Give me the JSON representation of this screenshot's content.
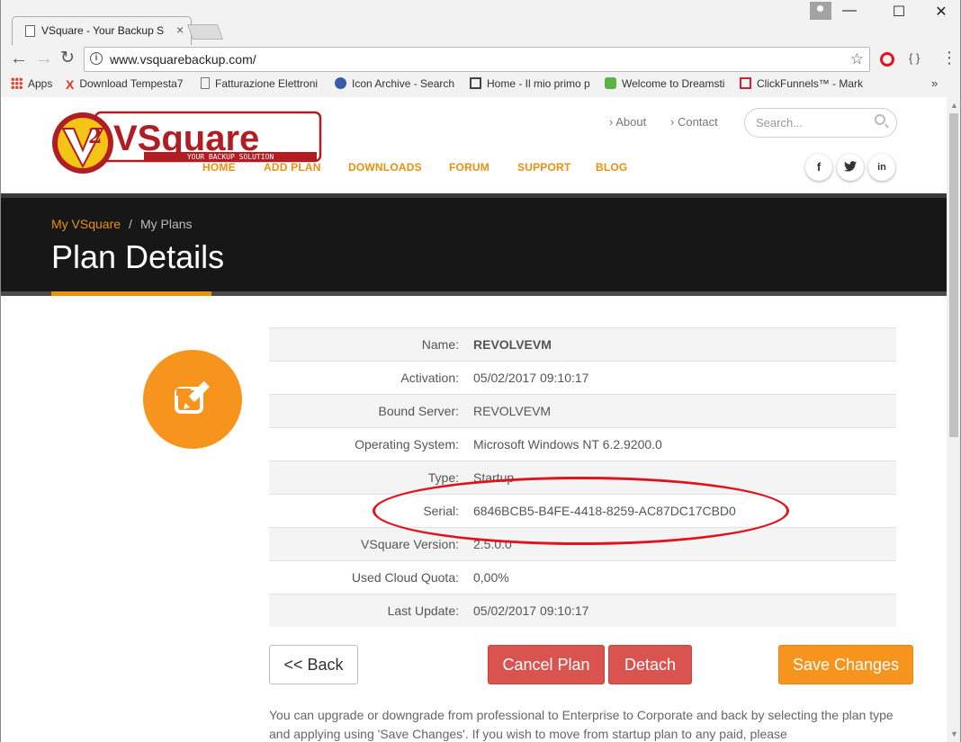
{
  "browser": {
    "tab_title": "VSquare - Your Backup S",
    "url": "www.vsquarebackup.com/",
    "window_controls": {
      "minimize": "—",
      "maximize": "☐",
      "close": "✕"
    },
    "bookmarks": [
      {
        "label": "Apps"
      },
      {
        "label": "Download Tempesta7"
      },
      {
        "label": "Fatturazione Elettroni"
      },
      {
        "label": "Icon Archive - Search"
      },
      {
        "label": "Home - Il mio primo p"
      },
      {
        "label": "Welcome to Dreamsti"
      },
      {
        "label": "ClickFunnels™ - Mark"
      }
    ],
    "bookmarks_overflow": "»"
  },
  "header": {
    "logo_text": "VSquare",
    "logo_tagline": "YOUR BACKUP SOLUTION",
    "logo_badge": "2",
    "top_links": [
      "About",
      "Contact"
    ],
    "search_placeholder": "Search...",
    "nav": [
      "HOME",
      "ADD PLAN",
      "DOWNLOADS",
      "FORUM",
      "SUPPORT",
      "BLOG"
    ],
    "social": [
      "f",
      "t",
      "in"
    ]
  },
  "banner": {
    "breadcrumb": {
      "link": "My VSquare",
      "separator": "/",
      "current": "My Plans"
    },
    "title": "Plan Details"
  },
  "plan": {
    "rows": [
      {
        "label": "Name:",
        "value": "REVOLVEVM",
        "bold": true
      },
      {
        "label": "Activation:",
        "value": "05/02/2017 09:10:17"
      },
      {
        "label": "Bound Server:",
        "value": "REVOLVEVM"
      },
      {
        "label": "Operating System:",
        "value": "Microsoft Windows NT 6.2.9200.0"
      },
      {
        "label": "Type:",
        "value": "Startup"
      },
      {
        "label": "Serial:",
        "value": "6846BCB5-B4FE-4418-8259-AC87DC17CBD0"
      },
      {
        "label": "VSquare Version:",
        "value": "2.5.0.0"
      },
      {
        "label": "Used Cloud Quota:",
        "value": "0,00%"
      },
      {
        "label": "Last Update:",
        "value": "05/02/2017 09:10:17"
      }
    ]
  },
  "actions": {
    "back": "<< Back",
    "cancel": "Cancel Plan",
    "detach": "Detach",
    "save": "Save Changes"
  },
  "note": "You can upgrade or downgrade from professional to Enterprise to Corporate and back by selecting the plan type and applying using 'Save Changes'. If you wish to move from startup plan to any paid, please",
  "colors": {
    "accent": "#f7941d",
    "danger": "#d9534f",
    "banner": "#171717",
    "annotation": "#e0141e"
  }
}
